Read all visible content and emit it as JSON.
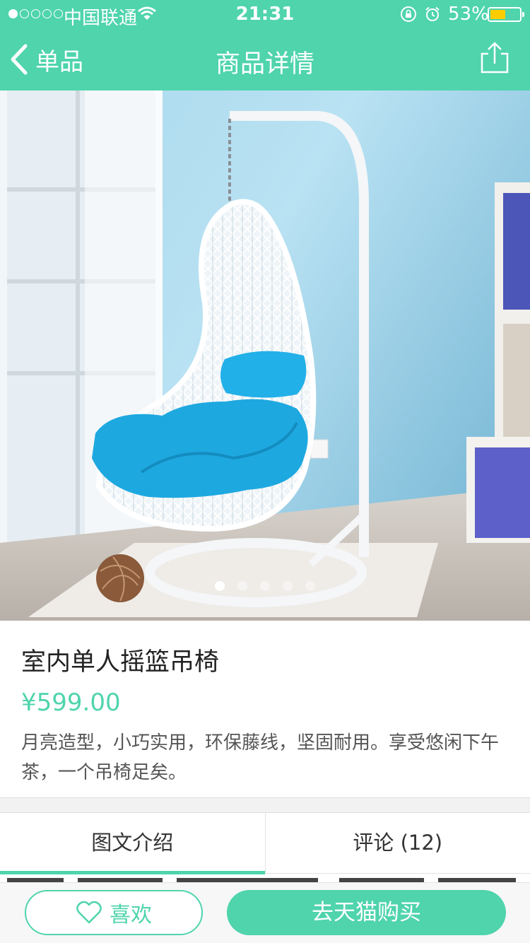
{
  "status_bar": {
    "carrier": "中国联通",
    "time": "21:31",
    "battery": "53%",
    "battery_level": 0.53,
    "signal_bars_filled": 1,
    "signal_bars_total": 5
  },
  "nav": {
    "back_label": "单品",
    "title": "商品详情",
    "share_icon": "share-icon"
  },
  "gallery": {
    "image": "white rattan egg hanging chair with blue cushions",
    "page_count": 5,
    "current_page": 1
  },
  "product": {
    "name": "室内单人摇篮吊椅",
    "price": "¥599.00",
    "description": "月亮造型，小巧实用，环保藤线，坚固耐用。享受悠闲下午茶，一个吊椅足矣。"
  },
  "tabs": [
    {
      "label": "图文介绍",
      "active": true
    },
    {
      "label": "评论 (12)",
      "active": false
    }
  ],
  "bottom_bar": {
    "like_label": "喜欢",
    "buy_label": "去天猫购买"
  },
  "colors": {
    "accent": "#4fd4ac",
    "battery": "#ffcc00",
    "cushion": "#1ea8e0"
  }
}
